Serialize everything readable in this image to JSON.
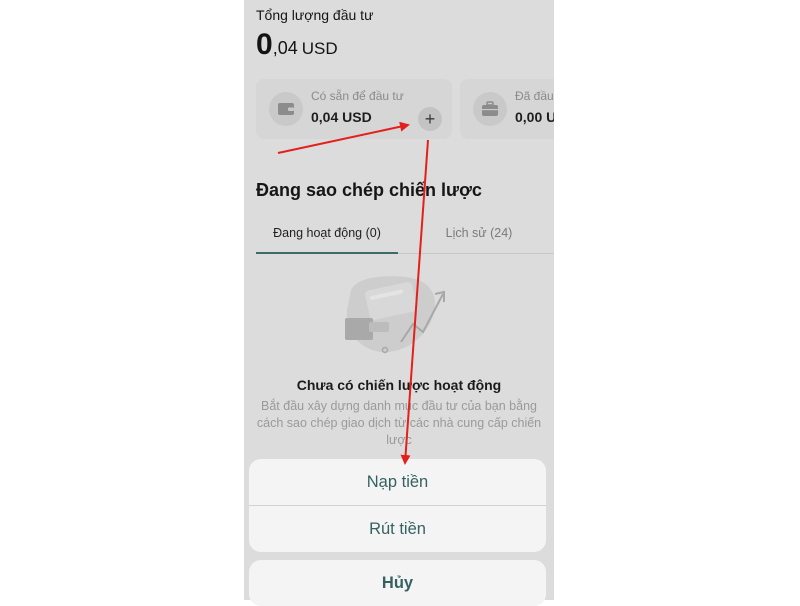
{
  "portfolio": {
    "total_label": "Tổng lượng đầu tư",
    "total_int": "0",
    "total_dec": ",04",
    "total_currency": "USD"
  },
  "cards": {
    "available_label": "Có sẵn để đầu tư",
    "available_value": "0,04 USD",
    "invested_label": "Đã đầu",
    "invested_value": "0,00 U"
  },
  "strategies": {
    "title": "Đang sao chép chiến lược",
    "tabs": [
      {
        "label": "Đang hoạt động (0)",
        "active": true
      },
      {
        "label": "Lịch sử (24)",
        "active": false
      }
    ],
    "empty_title": "Chưa có chiến lược hoạt động",
    "empty_desc": "Bắt đầu xây dựng danh mục đầu tư của bạn bằng cách sao chép giao dịch từ các nhà cung cấp chiến lược"
  },
  "action_sheet": {
    "deposit": "Nạp tiền",
    "withdraw": "Rút tiền",
    "cancel": "Hủy"
  },
  "colors": {
    "accent": "#356260",
    "annotation_arrow": "#e3201b"
  },
  "icons": [
    "wallet-icon",
    "briefcase-icon",
    "plus-icon",
    "empty-strategy-illustration"
  ]
}
